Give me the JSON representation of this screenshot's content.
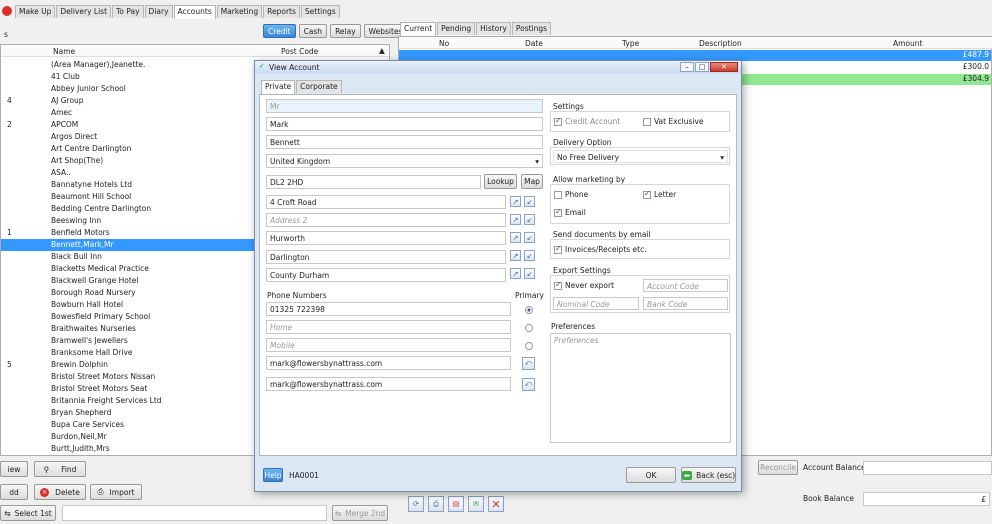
{
  "tabs": [
    "Make Up",
    "Delivery List",
    "To Pay",
    "Diary",
    "Accounts",
    "Marketing",
    "Reports",
    "Settings"
  ],
  "left": {
    "filter_buttons": [
      "Credit",
      "Cash",
      "Relay",
      "Websites"
    ],
    "col_name": "Name",
    "col_postcode": "Post Code",
    "rows": [
      {
        "num": "",
        "name": "(Area Manager),Jeanette."
      },
      {
        "num": "",
        "name": "41 Club"
      },
      {
        "num": "",
        "name": "Abbey Junior School"
      },
      {
        "num": "4",
        "name": "AJ Group"
      },
      {
        "num": "",
        "name": "Amec"
      },
      {
        "num": "2",
        "name": "APCOM"
      },
      {
        "num": "",
        "name": "Argos Direct"
      },
      {
        "num": "",
        "name": "Art Centre Darlington"
      },
      {
        "num": "",
        "name": "Art Shop(The)"
      },
      {
        "num": "",
        "name": "ASA.."
      },
      {
        "num": "",
        "name": "Bannatyne Hotels Ltd"
      },
      {
        "num": "",
        "name": "Beaumont Hill School"
      },
      {
        "num": "",
        "name": "Bedding Centre Darlington"
      },
      {
        "num": "",
        "name": "Beeswing Inn"
      },
      {
        "num": "1",
        "name": "Benfield Motors"
      },
      {
        "num": "",
        "name": "Bennett,Mark,Mr"
      },
      {
        "num": "",
        "name": "Black Bull Inn"
      },
      {
        "num": "",
        "name": "Blacketts Medical Practice"
      },
      {
        "num": "",
        "name": "Blackwell Grange Hotel"
      },
      {
        "num": "",
        "name": "Borough Road Nursery"
      },
      {
        "num": "",
        "name": "Bowburn Hall Hotel"
      },
      {
        "num": "",
        "name": "Bowesfield Primary School"
      },
      {
        "num": "",
        "name": "Braithwaites Nurseries"
      },
      {
        "num": "",
        "name": "Bramwell's Jewellers"
      },
      {
        "num": "",
        "name": "Branksome Hall Drive"
      },
      {
        "num": "5",
        "name": "Brewin Dolphin"
      },
      {
        "num": "",
        "name": "Bristol Street Motors Nissan"
      },
      {
        "num": "",
        "name": "Bristol Street Motors Seat"
      },
      {
        "num": "",
        "name": "Britannia Freight Services Ltd"
      },
      {
        "num": "",
        "name": "Bryan Shepherd"
      },
      {
        "num": "",
        "name": "Bupa Care Services"
      },
      {
        "num": "",
        "name": "Burdon,Neil,Mr"
      },
      {
        "num": "",
        "name": "Burtt,Judith,Mrs"
      }
    ],
    "view_btn": "iew",
    "find_btn": "Find",
    "add_btn": "dd",
    "delete_btn": "Delete",
    "import_btn": "Import",
    "select_btn": "Select 1st",
    "merge_btn": "Merge 2nd"
  },
  "right": {
    "tabs": [
      "Current",
      "Pending",
      "History",
      "Postings"
    ],
    "col_no": "No",
    "col_date": "Date",
    "col_type": "Type",
    "col_desc": "Description",
    "col_amount": "Amount",
    "amounts": [
      "£487.9",
      "£300.0",
      "£304.9"
    ],
    "reconcile": "Reconcile",
    "account_balance": "Account Balance",
    "book_balance": "Book Balance",
    "book_value": "£"
  },
  "dialog": {
    "title": "View Account",
    "tabs": [
      "Private",
      "Corporate"
    ],
    "title_field": "Mr",
    "first_name": "Mark",
    "last_name": "Bennett",
    "country": "United Kingdom",
    "postcode": "DL2 2HD",
    "lookup": "Lookup",
    "map": "Map",
    "address1": "4 Croft Road",
    "address2": "Address 2",
    "address3": "Hurworth",
    "town": "Darlington",
    "county": "County Durham",
    "phone_numbers": "Phone Numbers",
    "primary": "Primary",
    "phone": "01325 722398",
    "home": "Home",
    "mobile": "Mobile",
    "email1": "mark@flowersbynattrass.com",
    "email2": "mark@flowersbynattrass.com",
    "settings": "Settings",
    "credit_account": "Credit Account",
    "vat_exclusive": "Vat Exclusive",
    "delivery_option": "Delivery Option",
    "delivery_value": "No Free Delivery",
    "allow_marketing": "Allow marketing by",
    "phone_opt": "Phone",
    "letter_opt": "Letter",
    "email_opt": "Email",
    "send_docs": "Send documents by email",
    "invoices": "Invoices/Receipts etc.",
    "export_settings": "Export Settings",
    "never_export": "Never export",
    "account_code": "Account Code",
    "nominal_code": "Nominal Code",
    "bank_code": "Bank Code",
    "preferences": "Preferences",
    "preferences_ph": "Preferences",
    "help": "Help",
    "account_no": "HA0001",
    "ok": "OK",
    "back": "Back (esc)"
  }
}
